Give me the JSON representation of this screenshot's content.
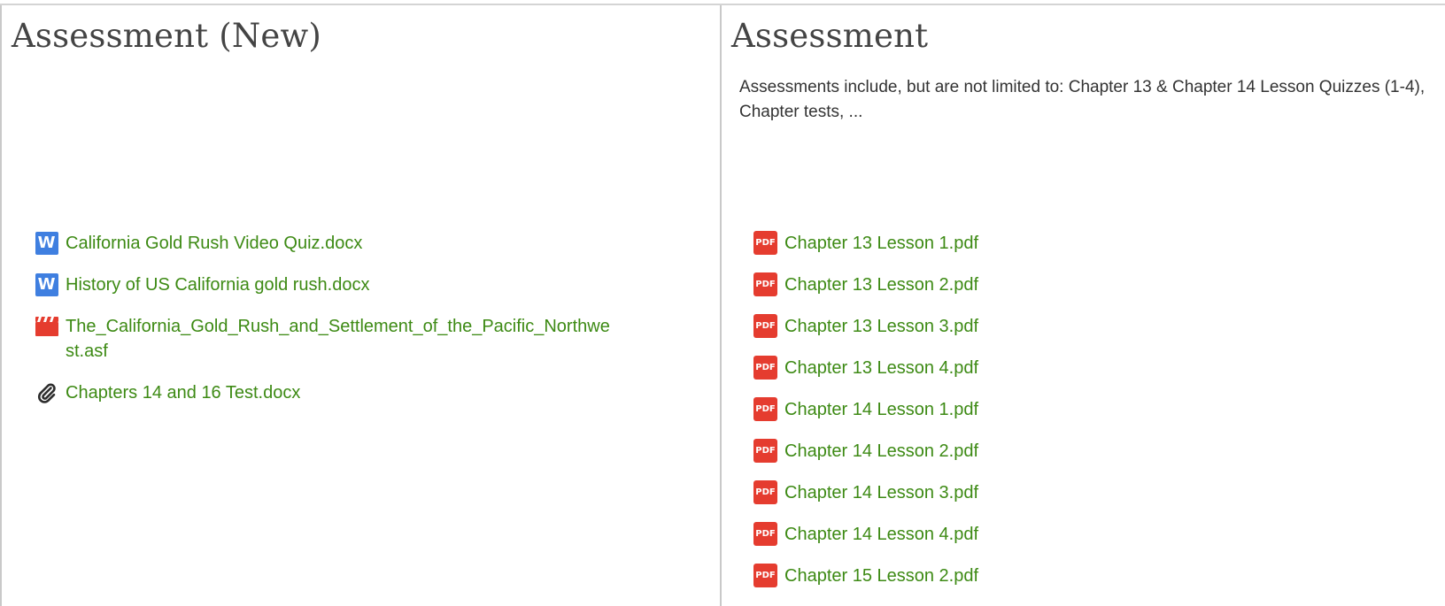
{
  "left": {
    "title": "Assessment (New)",
    "files": [
      {
        "name": "California Gold Rush Video Quiz.docx",
        "icon": "word-doc-icon",
        "icon_text": "W"
      },
      {
        "name": "History of US California gold rush.docx",
        "icon": "word-doc-icon",
        "icon_text": "W"
      },
      {
        "name": "The_California_Gold_Rush_and_Settlement_of_the_Pacific_Northwest.asf",
        "icon": "video-clapper-icon",
        "icon_text": ""
      },
      {
        "name": "Chapters 14 and 16 Test.docx",
        "icon": "paperclip-icon",
        "icon_text": ""
      }
    ]
  },
  "right": {
    "title": "Assessment",
    "description": "Assessments include, but are not limited to: Chapter 13 & Chapter 14 Lesson Quizzes (1-4), Chapter tests, ...",
    "files": [
      {
        "name": "Chapter 13 Lesson 1.pdf",
        "icon": "pdf-icon",
        "icon_text": "PDF"
      },
      {
        "name": "Chapter 13 Lesson 2.pdf",
        "icon": "pdf-icon",
        "icon_text": "PDF"
      },
      {
        "name": "Chapter 13 Lesson 3.pdf",
        "icon": "pdf-icon",
        "icon_text": "PDF"
      },
      {
        "name": "Chapter 13 Lesson 4.pdf",
        "icon": "pdf-icon",
        "icon_text": "PDF"
      },
      {
        "name": "Chapter 14 Lesson 1.pdf",
        "icon": "pdf-icon",
        "icon_text": "PDF"
      },
      {
        "name": "Chapter 14 Lesson 2.pdf",
        "icon": "pdf-icon",
        "icon_text": "PDF"
      },
      {
        "name": "Chapter 14 Lesson 3.pdf",
        "icon": "pdf-icon",
        "icon_text": "PDF"
      },
      {
        "name": "Chapter 14 Lesson 4.pdf",
        "icon": "pdf-icon",
        "icon_text": "PDF"
      },
      {
        "name": "Chapter 15 Lesson 2.pdf",
        "icon": "pdf-icon",
        "icon_text": "PDF"
      }
    ]
  },
  "colors": {
    "link": "#3d8a14",
    "heading": "#444444",
    "body_text": "#333333",
    "word_icon": "#3f7fe0",
    "pdf_icon": "#e53c2f",
    "border": "#c9c9c9"
  }
}
